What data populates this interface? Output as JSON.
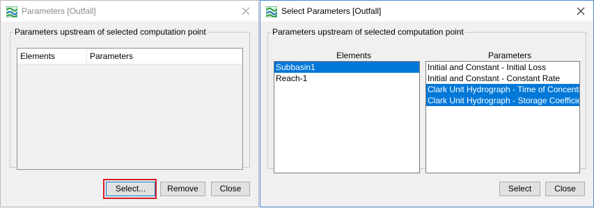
{
  "left_dialog": {
    "title": "Parameters [Outfall]",
    "group_label": "Parameters upstream of selected computation point",
    "columns": [
      "Elements",
      "Parameters"
    ],
    "buttons": {
      "select": "Select...",
      "remove": "Remove",
      "close": "Close"
    }
  },
  "right_dialog": {
    "title": "Select Parameters [Outfall]",
    "group_label": "Parameters upstream of selected computation point",
    "elements_header": "Elements",
    "parameters_header": "Parameters",
    "elements": [
      {
        "label": "Subbasin1",
        "selected": true
      },
      {
        "label": "Reach-1",
        "selected": false
      }
    ],
    "parameters": [
      {
        "label": "Initial and Constant - Initial Loss",
        "selected": false
      },
      {
        "label": "Initial and Constant - Constant Rate",
        "selected": false
      },
      {
        "label": "Clark Unit Hydrograph - Time of Concentration",
        "selected": true
      },
      {
        "label": "Clark Unit Hydrograph - Storage Coefficient",
        "selected": true
      }
    ],
    "buttons": {
      "select": "Select",
      "close": "Close"
    }
  },
  "colors": {
    "selection": "#0078d7",
    "highlight": "#d91c24",
    "icon_green": "#2e9b45"
  },
  "icons": {
    "app_icon": "app-logo-icon",
    "close_icon": "close-icon"
  }
}
